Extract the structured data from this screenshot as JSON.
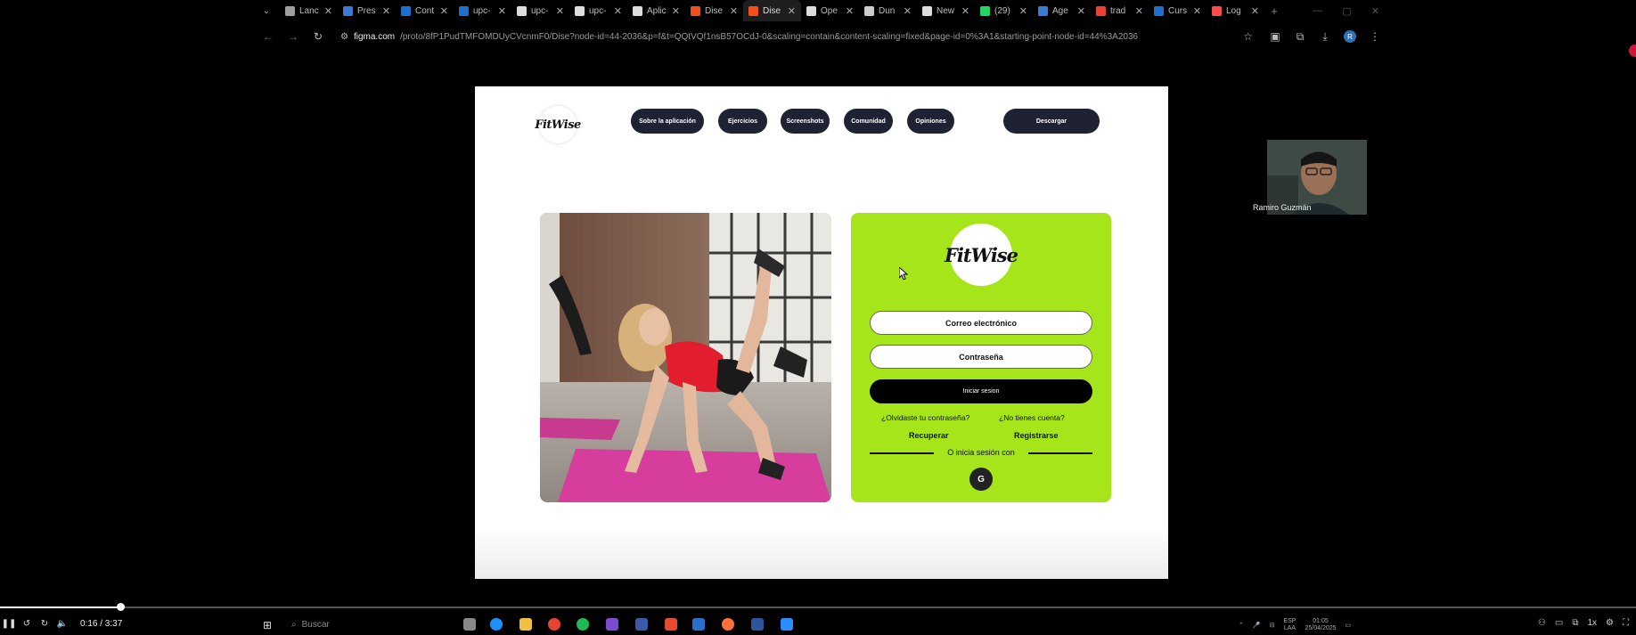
{
  "browser": {
    "tabs": [
      {
        "label": "Lanc",
        "favicon_color": "#9e9e9e"
      },
      {
        "label": "Pres",
        "favicon_color": "#3a7bd5"
      },
      {
        "label": "Cont",
        "favicon_color": "#1f6fd1"
      },
      {
        "label": "upc-",
        "favicon_color": "#1f6fd1"
      },
      {
        "label": "upc-",
        "favicon_color": "#dddddd"
      },
      {
        "label": "upc-",
        "favicon_color": "#dddddd"
      },
      {
        "label": "Aplic",
        "favicon_color": "#dddddd"
      },
      {
        "label": "Dise",
        "favicon_color": "#f24e1e"
      },
      {
        "label": "Dise",
        "favicon_color": "#f24e1e"
      },
      {
        "label": "Ope",
        "favicon_color": "#dddddd"
      },
      {
        "label": "Dun",
        "favicon_color": "#cccccc"
      },
      {
        "label": "New",
        "favicon_color": "#dddddd"
      },
      {
        "label": "(29)",
        "favicon_color": "#25d366"
      },
      {
        "label": "Age",
        "favicon_color": "#3a7bd5"
      },
      {
        "label": "trad",
        "favicon_color": "#ea4335"
      },
      {
        "label": "Curs",
        "favicon_color": "#1f6fd1"
      },
      {
        "label": "Log",
        "favicon_color": "#ff4b4b"
      }
    ],
    "active_tab_index": 8,
    "new_tab_symbol": "+",
    "address": {
      "host": "figma.com",
      "path": "/proto/8fP1PudTMFOMDUyCVcnmF0/Dise?node-id=44-2036&p=f&t=QQtVQf1nsB57OCdJ-0&scaling=contain&content-scaling=fixed&page-id=0%3A1&starting-point-node-id=44%3A2036"
    },
    "profile_initial": "R"
  },
  "prototype": {
    "logo_text": "FitWise",
    "nav": [
      {
        "label": "Sobre la aplicación"
      },
      {
        "label": "Ejercicios"
      },
      {
        "label": "Screenshots"
      },
      {
        "label": "Comunidad"
      },
      {
        "label": "Opiniones"
      }
    ],
    "download_label": "Descargar",
    "login": {
      "email_label": "Correo electrónico",
      "password_label": "Contraseña",
      "submit_label": "Iniciar sesion",
      "forgot_question": "¿Olvidaste tu contraseña?",
      "no_account_question": "¿No tienes cuenta?",
      "recover_link": "Recuperar",
      "register_link": "Registrarse",
      "or_text": "O inicia sesión con",
      "google_label": "G"
    },
    "colors": {
      "accent_green": "#a6e51a",
      "nav_pill": "#1f2233",
      "mat_pink": "#e040a0",
      "top_red": "#e02020"
    }
  },
  "webcam": {
    "name": "Ramiro Guzmán"
  },
  "player": {
    "current_time": "0:16",
    "total_time": "3:37",
    "time_display": "0:16 / 3:37",
    "progress_fraction": 0.0737,
    "speed_label": "1x"
  },
  "taskbar": {
    "search_placeholder": "Buscar",
    "language_line1": "ESP",
    "language_line2": "LAA",
    "time": "01:05",
    "date": "25/04/2025"
  }
}
